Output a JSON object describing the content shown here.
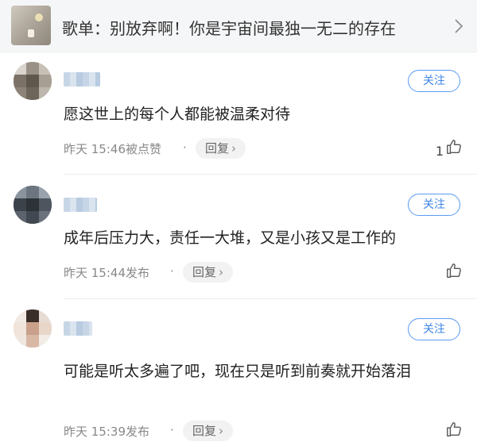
{
  "playlist": {
    "title": "歌单：别放弃啊！你是宇宙间最独一无二的存在",
    "thumbnail_icon": "playlist-cover-image",
    "chevron_icon": "chevron-right-icon"
  },
  "colors": {
    "accent": "#3f86e6",
    "header_bg": "#f5f6f7",
    "meta_text": "#888888"
  },
  "comments": [
    {
      "username": "",
      "follow_label": "关注",
      "text": "愿这世上的每个人都能被温柔对待",
      "time": "昨天 15:46被点赞",
      "reply_label": "回复",
      "like_count": "1",
      "like_icon": "thumbs-up-icon"
    },
    {
      "username": "",
      "follow_label": "关注",
      "text": "成年后压力大，责任一大堆，又是小孩又是工作的",
      "time": "昨天 15:44发布",
      "reply_label": "回复",
      "like_count": "",
      "like_icon": "thumbs-up-icon"
    },
    {
      "username": "",
      "follow_label": "关注",
      "text": "可能是听太多遍了吧，现在只是听到前奏就开始落泪",
      "time": "昨天 15:39发布",
      "reply_label": "回复",
      "like_count": "",
      "like_icon": "thumbs-up-icon"
    }
  ]
}
